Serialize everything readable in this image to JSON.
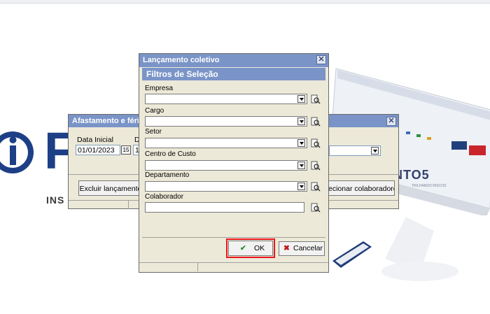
{
  "background": {
    "logo_letter": "F",
    "logo_subtext": "INS",
    "brand_text": "NTO5",
    "brand_subtext": "TRILHANDO RISCOS"
  },
  "back_window": {
    "title": "Afastamento e férias",
    "data_inicial_label": "Data Inicial",
    "data_inicial_value": "01/01/2023",
    "data_final_label": "Da",
    "data_final_value": "15",
    "excluir_button": "Excluir lançamento",
    "selecionar_button": "ecionar colaboradores"
  },
  "dialog": {
    "title": "Lançamento coletivo",
    "section_header": "Filtros de Seleção",
    "fields": [
      {
        "label": "Empresa",
        "value": ""
      },
      {
        "label": "Cargo",
        "value": ""
      },
      {
        "label": "Setor",
        "value": ""
      },
      {
        "label": "Centro de Custo",
        "value": ""
      },
      {
        "label": "Departamento",
        "value": ""
      },
      {
        "label": "Colaborador",
        "value": ""
      }
    ],
    "ok_button": "OK",
    "cancel_button": "Cancelar"
  },
  "colors": {
    "titlebar": "#7a94c8",
    "window_bg": "#ece9d8",
    "highlight": "#e8161b",
    "brand_blue": "#1d3f86"
  },
  "icons": [
    "close-icon",
    "dropdown-arrow-icon",
    "lookup-icon",
    "calendar-icon",
    "check-icon",
    "cancel-x-icon"
  ]
}
